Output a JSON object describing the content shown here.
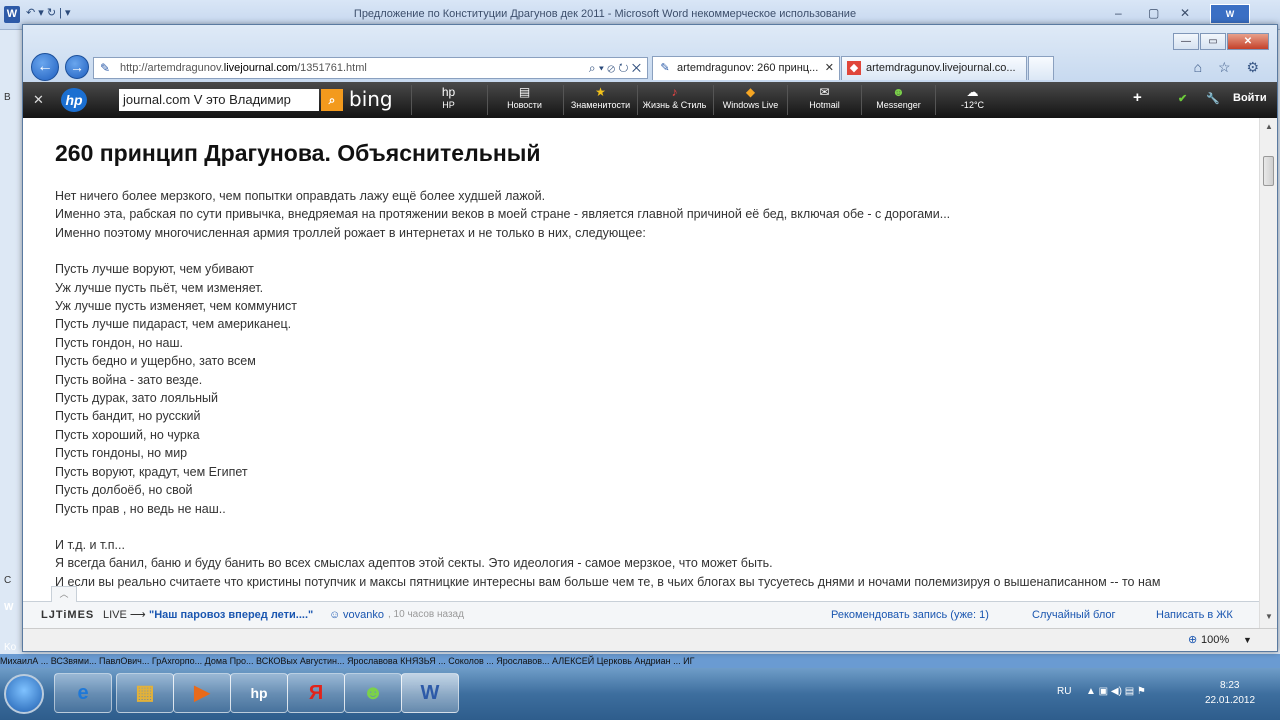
{
  "word": {
    "title": "Предложение по Конституции  Драгунов   дек  2011  -  Microsoft Word некоммерческое использование",
    "logo": "W",
    "qat": "↶ ▾  ↻ | ▾",
    "min": "‒",
    "max": "▢",
    "close": "✕",
    "right_icon": "W",
    "left_stubs": [
      "B",
      "C",
      "W",
      "Ko"
    ],
    "status_strip": "МихаилА ...  ВСЗвями...  ПавлОвич...  ГрАхгорпо...                                        Дома Про...   ВСКОВых    Августин...  Ярославова  КНЯЗЬЯ ...  Соколов ...  Ярославов...   АЛЕКСЕЙ       Церковь                                              Андриан ...  ИГ"
  },
  "ie": {
    "back": "←",
    "forward": "→",
    "address": {
      "url_prefix": "http://artemdragunov.",
      "url_domain": "livejournal.com",
      "url_suffix": "/1351761.html",
      "tools": "⌕ ▾  ⊘ ↻ ✕"
    },
    "tabs": [
      {
        "label": "artemdragunov: 260 принц...",
        "close": "✕"
      },
      {
        "label": "artemdragunov.livejournal.co...",
        "close": ""
      }
    ],
    "window": {
      "minimize": "—",
      "maximize": "▭",
      "close": "✕"
    },
    "right_tools": "⌂ ☆ ⚙"
  },
  "hpbar": {
    "close": "✕",
    "logo": "hp",
    "search_value": "journal.com  V  это  Владимир",
    "search_btn": "⌕",
    "bing": "bing",
    "items": [
      {
        "icon": "hp",
        "label": "HP"
      },
      {
        "icon": "▤",
        "label": "Новости"
      },
      {
        "icon": "★",
        "label": "Знаменитости"
      },
      {
        "icon": "♪",
        "label": "Жизнь & Стиль"
      },
      {
        "icon": "◆",
        "label": "Windows Live"
      },
      {
        "icon": "✉",
        "label": "Hotmail"
      },
      {
        "icon": "☻",
        "label": "Messenger"
      },
      {
        "icon": "☁",
        "label": "-12°C"
      }
    ],
    "plus": "+",
    "shield": "✔",
    "login": "Войти"
  },
  "article": {
    "title": "260 принцип Драгунова. Объяснительный",
    "intro": [
      "Нет ничего более мерзкого, чем попытки оправдать лажу ещё более худшей лажой.",
      "Именно эта, рабская по сути привычка, внедряемая на протяжении веков в моей стране - является главной причиной её бед, включая обе - с дорогами...",
      "Именно поэтому многочисленная армия троллей рожает в интернетах и не только в них, следующее:"
    ],
    "list": [
      "Пусть лучше воруют, чем убивают",
      "Уж лучше пусть пьёт, чем изменяет.",
      "Уж лучше пусть изменяет, чем коммунист",
      "Пусть лучше пидараст, чем американец.",
      "Пусть гондон, но наш.",
      "Пусть бедно и ущербно, зато всем",
      "Пусть война - зато везде.",
      "Пусть дурак, зато лояльный",
      "Пусть бандит, но русский",
      "Пусть хороший, но чурка",
      "Пусть гондоны, но мир",
      "Пусть воруют, крадут, чем Египет",
      "Пусть долбоёб, но свой",
      "Пусть прав , но ведь не наш.."
    ],
    "outro": [
      "И т.д. и т.п...",
      "Я всегда банил, баню и буду банить во всех смыслах адептов этой секты. Это идеология - самое мерзкое, что может быть.",
      "И если вы реально считаете что кристины потупчик и максы пятницкие интересны вам больше чем те, в чьих блогах вы тусуетесь днями и ночами полемизируя о вышенаписанном -- то нам"
    ]
  },
  "ljtimes": {
    "up": "︿",
    "brand": "LJTiMES",
    "live": "LIVE ⟶",
    "headline": "\"Наш паровоз вперед лети....\"",
    "user": "vovanko",
    "time": ", 10 часов назад",
    "recommend": "Рекомендовать запись (уже: 1)",
    "random": "Случайный блог",
    "write": "Написать в ЖК"
  },
  "status": {
    "zoom": "100%",
    "zoom_arrow": "▼"
  },
  "taskbar": {
    "apps": [
      "e",
      "▦",
      "▶",
      "hp",
      "Я",
      "☻",
      "W"
    ],
    "lang": "RU",
    "tray_icons": "▲  ▣  ◀)  ▤  ⚑",
    "time": "8:23",
    "date": "22.01.2012"
  }
}
